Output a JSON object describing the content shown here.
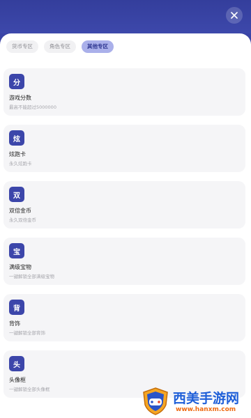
{
  "header": {
    "close_icon": "close-icon",
    "accent_color": "#3a44a6"
  },
  "tabs": [
    {
      "label": "货币专区",
      "active": false
    },
    {
      "label": "角色专区",
      "active": false
    },
    {
      "label": "其他专区",
      "active": true
    }
  ],
  "items": [
    {
      "icon_char": "分",
      "title": "游戏分数",
      "desc": "最高不能超过5000000"
    },
    {
      "icon_char": "炫",
      "title": "炫跑卡",
      "desc": "永久炫跑卡"
    },
    {
      "icon_char": "双",
      "title": "双倍金币",
      "desc": "永久双倍金币"
    },
    {
      "icon_char": "宝",
      "title": "满级宝物",
      "desc": "一键解锁全部满级宝物"
    },
    {
      "icon_char": "背",
      "title": "背饰",
      "desc": "一键解锁全部背饰"
    },
    {
      "icon_char": "头",
      "title": "头像框",
      "desc": "一键解锁全部头像框"
    }
  ],
  "watermark": {
    "brand": "西美手游网",
    "url": "www.hanxm.com"
  }
}
